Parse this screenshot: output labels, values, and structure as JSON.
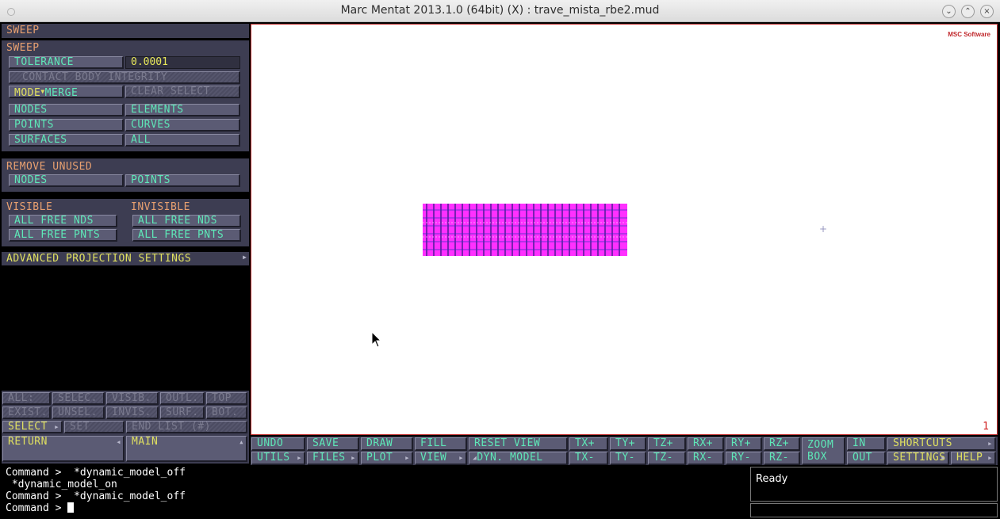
{
  "window": {
    "title": "Marc Mentat 2013.1.0 (64bit) (X) : trave_mista_rbe2.mud"
  },
  "panel": {
    "menu_title": "SWEEP",
    "sweep": {
      "header": "SWEEP",
      "tolerance_label": "TOLERANCE",
      "tolerance_value": "0.0001",
      "contact_body_integrity": "CONTACT BODY INTEGRITY",
      "mode_label": "MODE",
      "mode_value": "MERGE",
      "clear_select": "CLEAR SELECT",
      "nodes": "NODES",
      "elements": "ELEMENTS",
      "points": "POINTS",
      "curves": "CURVES",
      "surfaces": "SURFACES",
      "all": "ALL"
    },
    "remove_unused": {
      "header": "REMOVE UNUSED",
      "nodes": "NODES",
      "points": "POINTS"
    },
    "visible": {
      "header": "VISIBLE",
      "free_nds": "ALL FREE NDS",
      "free_pnts": "ALL FREE PNTS"
    },
    "invisible": {
      "header": "INVISIBLE",
      "free_nds": "ALL FREE NDS",
      "free_pnts": "ALL FREE PNTS"
    },
    "advanced": "ADVANCED PROJECTION SETTINGS",
    "selection_row1": [
      "ALL:",
      "SELEC.",
      "VISIB.",
      "OUTL.",
      "TOP"
    ],
    "selection_row2": [
      "EXIST.",
      "UNSEL.",
      "INVIS.",
      "SURF.",
      "BOT."
    ],
    "select": "SELECT",
    "set": "SET",
    "end_list": "END LIST (#)",
    "return": "RETURN",
    "main": "MAIN"
  },
  "viewport": {
    "logo": "MSC Software",
    "number": "1"
  },
  "toolbar": {
    "undo": "UNDO",
    "utils": "UTILS",
    "save": "SAVE",
    "files": "FILES",
    "draw": "DRAW",
    "plot": "PLOT",
    "fill": "FILL",
    "view": "VIEW",
    "reset_view": "RESET VIEW",
    "dyn_model": "DYN. MODEL",
    "txp": "TX+",
    "txm": "TX-",
    "typ": "TY+",
    "tym": "TY-",
    "tzp": "TZ+",
    "tzm": "TZ-",
    "rxp": "RX+",
    "rxm": "RX-",
    "ryp": "RY+",
    "rym": "RY-",
    "rzp": "RZ+",
    "rzm": "RZ-",
    "zoom_box_1": "ZOOM",
    "zoom_box_2": "BOX",
    "in": "IN",
    "out": "OUT",
    "shortcuts": "SHORTCUTS",
    "settings": "SETTINGS",
    "help": "HELP"
  },
  "command": {
    "lines": [
      "Command >  *dynamic_model_off",
      " *dynamic_model_on",
      "Command >  *dynamic_model_off"
    ],
    "prompt": "Command > "
  },
  "status": {
    "text": "Ready"
  },
  "colors": {
    "panel_bg": "#3d3d52",
    "button_text": "#5ee8b8",
    "header_text": "#e8a070",
    "field_text": "#e8e85a",
    "mesh": "#ff30ff"
  }
}
